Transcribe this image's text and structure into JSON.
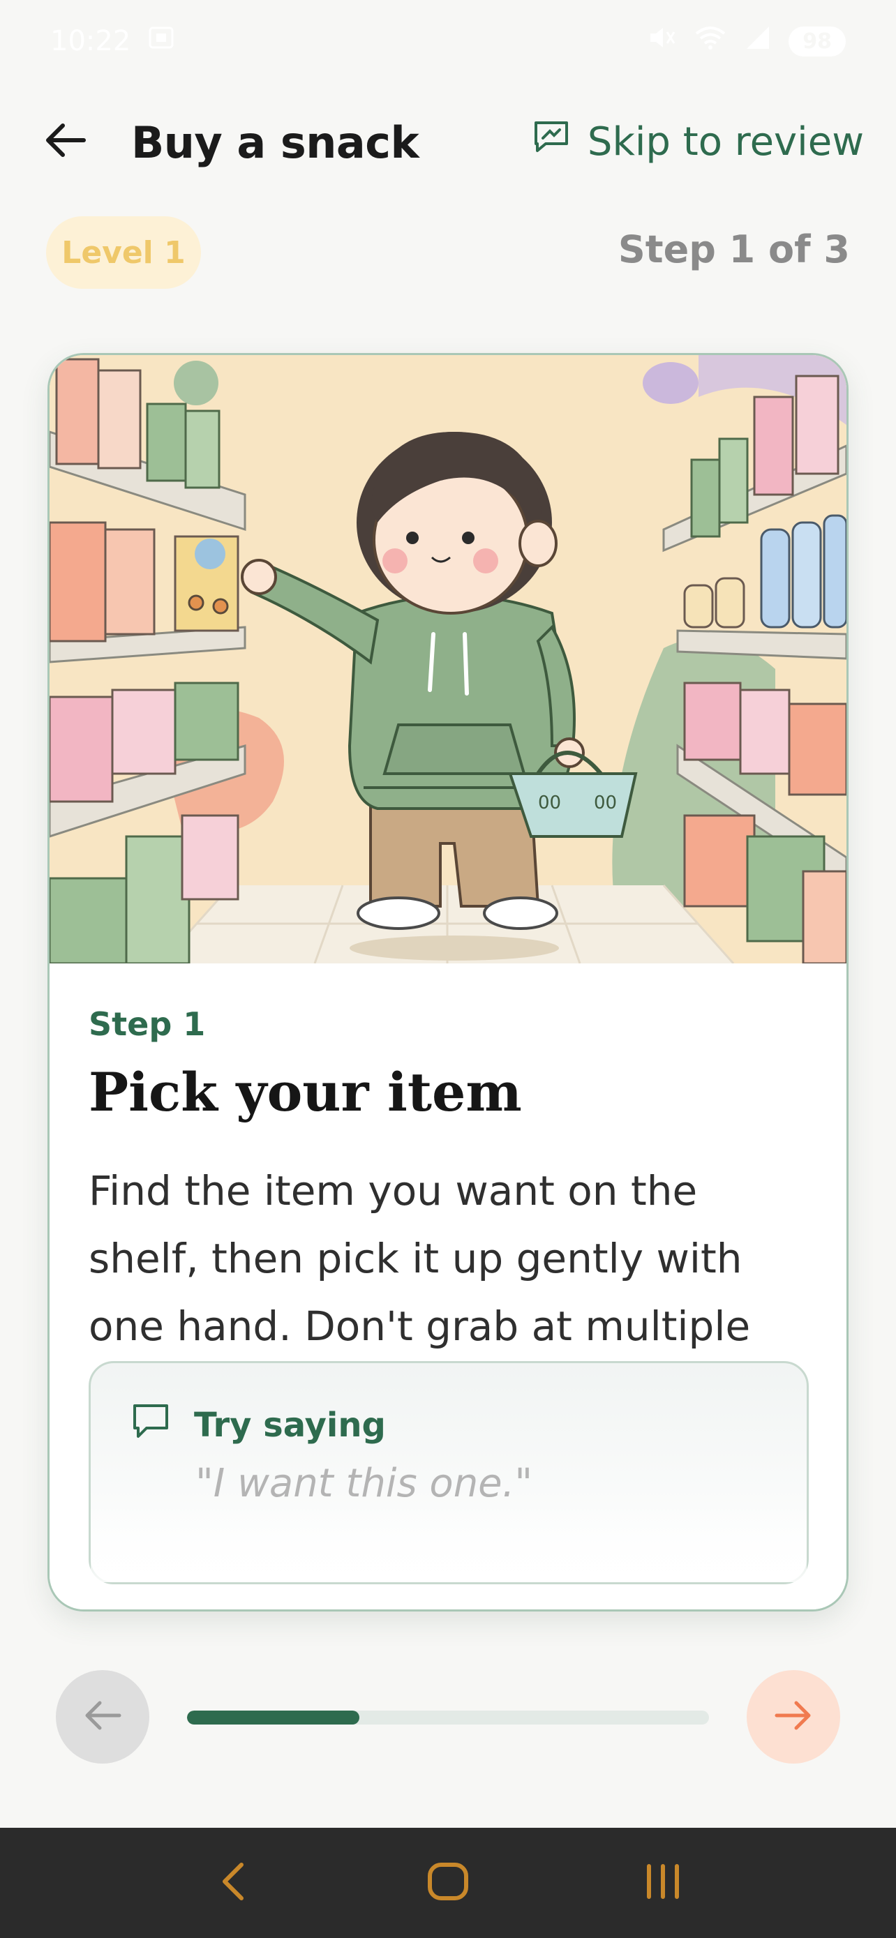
{
  "status_bar": {
    "time": "10:22",
    "battery": "98"
  },
  "header": {
    "title": "Buy a snack",
    "skip_label": "Skip to review",
    "back_icon": "arrow-left-icon",
    "skip_icon": "review-icon"
  },
  "meta": {
    "level_label": "Level 1",
    "step_counter": "Step 1 of 3"
  },
  "card": {
    "illustration": "child-picking-snack-in-store-illustration",
    "step_kicker": "Step 1",
    "step_title": "Pick your item",
    "description": "Find the item you want on the shelf, then pick it up gently with one hand. Don't grab at multiple things at once.",
    "try_saying": {
      "label": "Try saying",
      "quote": "\"I want this one.\"",
      "icon": "speech-bubble-icon"
    }
  },
  "navigation": {
    "progress": 0.33,
    "prev_icon": "arrow-left-icon",
    "next_icon": "arrow-right-icon"
  },
  "colors": {
    "accent_green": "#2e6b4e",
    "level_pill_bg": "#fdf1d6",
    "level_pill_text": "#efc86a",
    "next_button_bg": "#fde0d2",
    "next_arrow": "#f07a4f",
    "system_nav_bg": "#2b2b2b",
    "system_nav_icon": "#c9882a"
  }
}
